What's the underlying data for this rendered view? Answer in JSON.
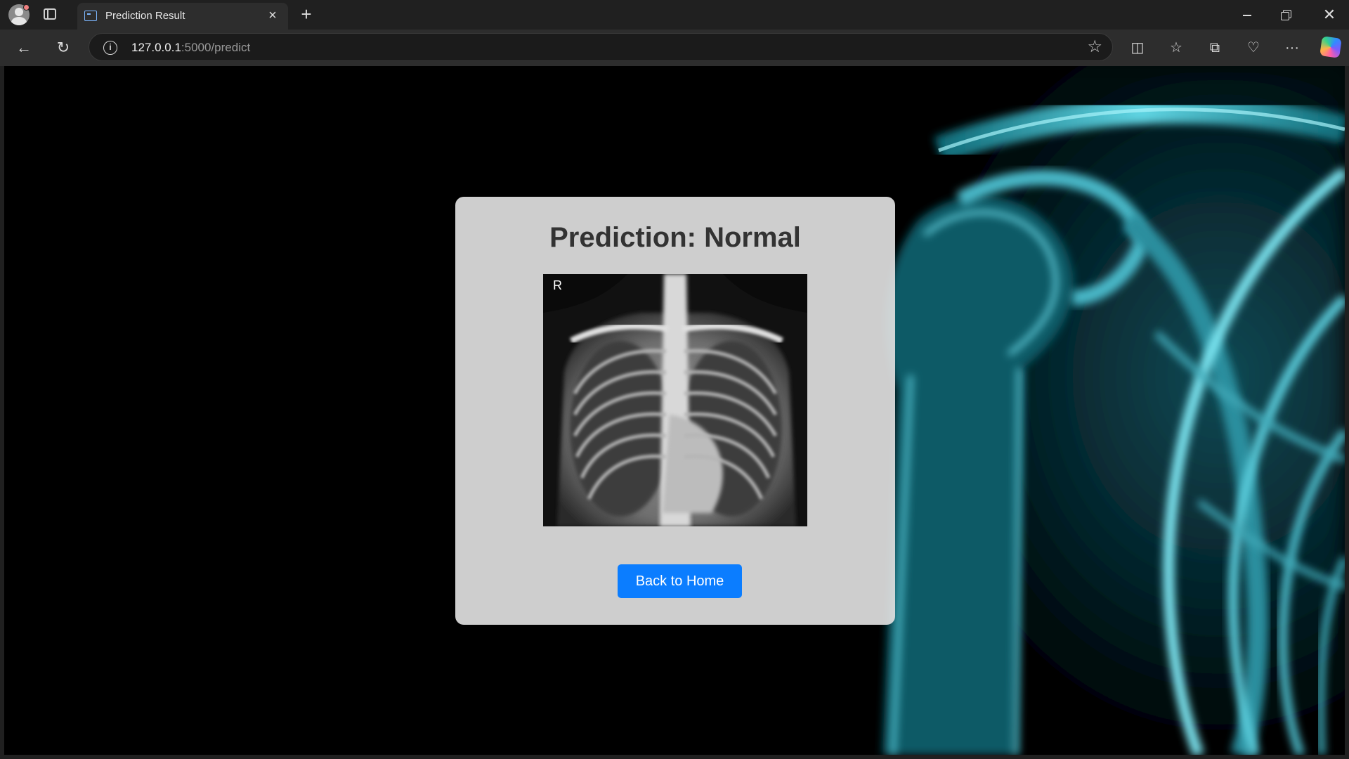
{
  "browser": {
    "tab": {
      "title": "Prediction Result",
      "favicon": "terminal-icon"
    },
    "address": {
      "host": "127.0.0.1",
      "rest": ":5000/predict"
    }
  },
  "page": {
    "title": "Prediction: Normal",
    "image_marker": "R",
    "button_label": "Back to Home",
    "accent_color": "#0b7dff"
  }
}
